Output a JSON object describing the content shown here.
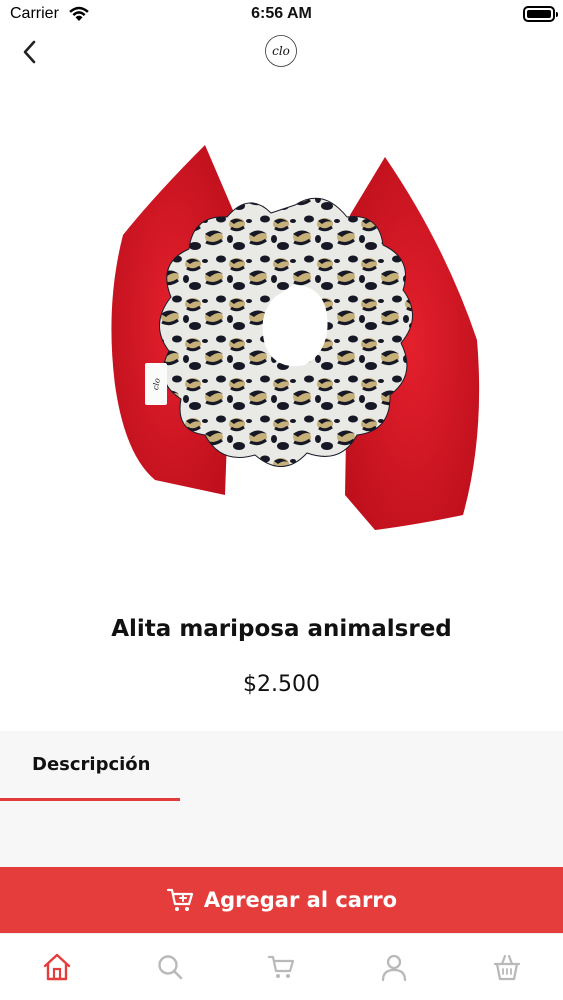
{
  "status_bar": {
    "carrier": "Carrier",
    "time": "6:56 AM"
  },
  "nav": {
    "back_icon": "chevron-left-icon",
    "logo_text": "clo"
  },
  "product": {
    "title": "Alita mariposa animalsred",
    "price": "$2.500",
    "tag_text": "clo"
  },
  "tabs": [
    {
      "label": "Descripción",
      "active": true
    }
  ],
  "add_to_cart": {
    "label": "Agregar al carro",
    "icon": "cart-icon",
    "color": "#e53c3c"
  },
  "bottom_nav": [
    {
      "name": "home",
      "icon": "home-icon",
      "active": true
    },
    {
      "name": "search",
      "icon": "search-icon",
      "active": false
    },
    {
      "name": "cart",
      "icon": "cart-icon",
      "active": false
    },
    {
      "name": "profile",
      "icon": "user-icon",
      "active": false
    },
    {
      "name": "orders",
      "icon": "basket-icon",
      "active": false
    }
  ],
  "colors": {
    "accent": "#e53c3c",
    "inactive_icon": "#b9b9b9"
  }
}
